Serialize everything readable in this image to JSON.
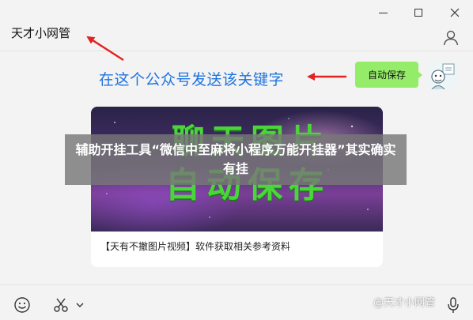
{
  "window": {
    "chat_title": "天才小网管"
  },
  "annotation": {
    "text": "在这个公众号发送该关键字",
    "color": "#1e73e0",
    "arrow_color": "#e02424"
  },
  "message": {
    "bubble_text": "自动保存",
    "bubble_color": "#95ec69"
  },
  "card": {
    "image_title": "聊天图片",
    "image_subtitle": "自动保存",
    "caption": "【天有不撤图片视频】软件获取相关参考资料"
  },
  "overlay": {
    "headline": "辅助开挂工具“微信中至麻将小程序万能开挂器”其实确实有挂"
  },
  "toolbar": {
    "watermark": "@天才小网管"
  },
  "icons": {
    "minimize": "minimize-icon",
    "maximize": "maximize-icon",
    "close": "close-icon",
    "contact": "person-icon",
    "emoji": "emoji-icon",
    "scissors": "scissors-icon",
    "chevron": "chevron-down-icon",
    "mic": "microphone-icon"
  }
}
